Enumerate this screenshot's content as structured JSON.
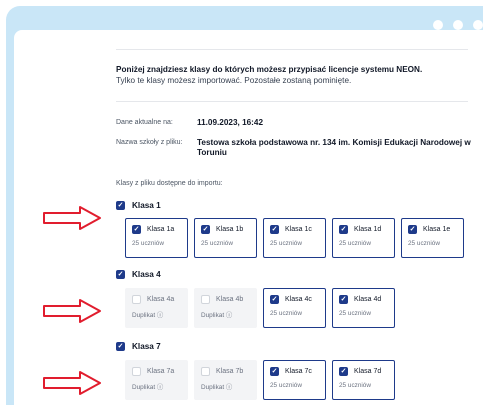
{
  "colors": {
    "accent": "#1e3a8a",
    "panel_bg": "#c9e6f7",
    "arrow_red": "#e11d2e",
    "disabled_bg": "#f3f4f6"
  },
  "intro": {
    "line1": "Poniżej znajdziesz klasy do których możesz przypisać licencje systemu NEON.",
    "line2": "Tylko te klasy możesz importować. Pozostałe zostaną pominięte."
  },
  "meta": {
    "date_label": "Dane aktualne na:",
    "date_value": "11.09.2023, 16:42",
    "school_label": "Nazwa szkoły z pliku:",
    "school_value": "Testowa szkoła podstawowa nr. 134 im. Komisji Edukacji Narodowej w Toruniu"
  },
  "available_label": "Klasy z pliku dostępne do importu:",
  "groups": [
    {
      "title": "Klasa 1",
      "checked": true,
      "cards": [
        {
          "name": "Klasa 1a",
          "sub": "25 uczniów",
          "disabled": false,
          "checked": true
        },
        {
          "name": "Klasa 1b",
          "sub": "25 uczniów",
          "disabled": false,
          "checked": true
        },
        {
          "name": "Klasa 1c",
          "sub": "25 uczniów",
          "disabled": false,
          "checked": true
        },
        {
          "name": "Klasa 1d",
          "sub": "25 uczniów",
          "disabled": false,
          "checked": true
        },
        {
          "name": "Klasa 1e",
          "sub": "25 uczniów",
          "disabled": false,
          "checked": true
        }
      ]
    },
    {
      "title": "Klasa 4",
      "checked": true,
      "cards": [
        {
          "name": "Klasa 4a",
          "sub": "Duplikat ⓘ",
          "disabled": true,
          "checked": false
        },
        {
          "name": "Klasa 4b",
          "sub": "Duplikat ⓘ",
          "disabled": true,
          "checked": false
        },
        {
          "name": "Klasa 4c",
          "sub": "25 uczniów",
          "disabled": false,
          "checked": true
        },
        {
          "name": "Klasa 4d",
          "sub": "25 uczniów",
          "disabled": false,
          "checked": true
        }
      ]
    },
    {
      "title": "Klasa 7",
      "checked": true,
      "cards": [
        {
          "name": "Klasa 7a",
          "sub": "Duplikat ⓘ",
          "disabled": true,
          "checked": false
        },
        {
          "name": "Klasa 7b",
          "sub": "Duplikat ⓘ",
          "disabled": true,
          "checked": false
        },
        {
          "name": "Klasa 7c",
          "sub": "25 uczniów",
          "disabled": false,
          "checked": true
        },
        {
          "name": "Klasa 7d",
          "sub": "25 uczniów",
          "disabled": false,
          "checked": true
        }
      ]
    }
  ]
}
